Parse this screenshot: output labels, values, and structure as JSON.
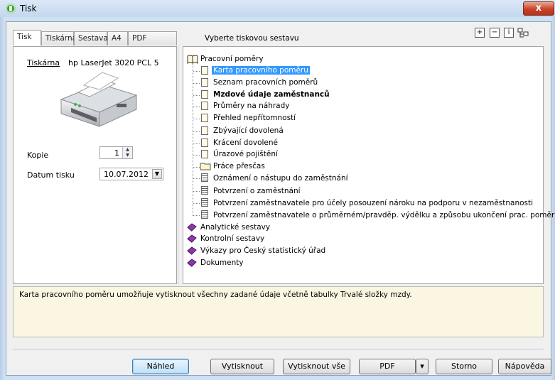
{
  "window": {
    "title": "Tisk",
    "close_label": "x"
  },
  "tabs": [
    {
      "label": "Tisk",
      "active": true
    },
    {
      "label": "Tiskárna",
      "active": false
    },
    {
      "label": "Sestava",
      "active": false
    },
    {
      "label": "A4",
      "active": false
    },
    {
      "label": "PDF",
      "active": false
    }
  ],
  "report_header": "Vyberte tiskovou sestavu",
  "toolbar": {
    "expand": "+",
    "collapse": "−",
    "info": "i",
    "tree_icon": "tree"
  },
  "left": {
    "printer_label": "Tiskárna",
    "printer_name": "hp LaserJet 3020 PCL 5",
    "copies_label": "Kopie",
    "copies_value": "1",
    "date_label": "Datum tisku",
    "date_value": "10.07.2012"
  },
  "tree": {
    "root": "Pracovní poměry",
    "items": [
      {
        "label": "Karta pracovního poměru",
        "icon": "doc",
        "selected": true,
        "bold": false
      },
      {
        "label": "Seznam pracovních poměrů",
        "icon": "doc",
        "selected": false,
        "bold": false
      },
      {
        "label": "Mzdové údaje zaměstnanců",
        "icon": "doc",
        "selected": false,
        "bold": true
      },
      {
        "label": "Průměry na náhrady",
        "icon": "doc",
        "selected": false,
        "bold": false
      },
      {
        "label": "Přehled nepřítomností",
        "icon": "doc",
        "selected": false,
        "bold": false
      },
      {
        "label": "Zbývající dovolená",
        "icon": "doc",
        "selected": false,
        "bold": false
      },
      {
        "label": "Krácení dovolené",
        "icon": "doc",
        "selected": false,
        "bold": false
      },
      {
        "label": "Úrazové pojištění",
        "icon": "doc",
        "selected": false,
        "bold": false
      },
      {
        "label": "Práce přesčas",
        "icon": "folder",
        "selected": false,
        "bold": false
      },
      {
        "label": "Oznámení o nástupu do zaměstnání",
        "icon": "form",
        "selected": false,
        "bold": false
      },
      {
        "label": "Potvrzení o zaměstnání",
        "icon": "form",
        "selected": false,
        "bold": false
      },
      {
        "label": "Potvrzení zaměstnavatele pro účely posouzení nároku na podporu v nezaměstnanosti",
        "icon": "form",
        "selected": false,
        "bold": false
      },
      {
        "label": "Potvrzení zaměstnavatele o průměrném/pravděp. výdělku a způsobu ukončení prac. poměru",
        "icon": "form",
        "selected": false,
        "bold": false
      }
    ],
    "groups": [
      {
        "label": "Analytické sestavy"
      },
      {
        "label": "Kontrolní sestavy"
      },
      {
        "label": "Výkazy pro Český statistický úřad"
      },
      {
        "label": "Dokumenty"
      }
    ]
  },
  "description": "Karta pracovního poměru umožňuje vytisknout všechny zadané údaje včetně tabulky Trvalé složky mzdy.",
  "buttons": {
    "preview": "Náhled",
    "print": "Vytisknout",
    "print_all": "Vytisknout vše",
    "pdf": "PDF",
    "cancel": "Storno",
    "help": "Nápověda"
  }
}
